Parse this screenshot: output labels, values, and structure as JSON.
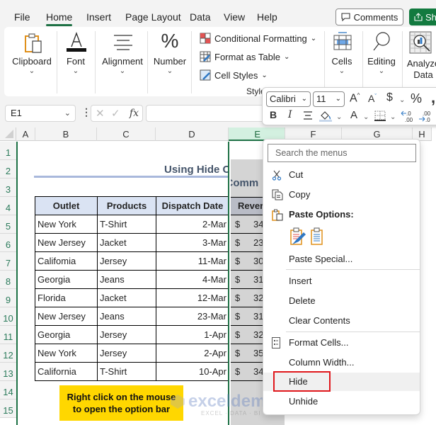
{
  "menubar": {
    "tabs": [
      "File",
      "Home",
      "Insert",
      "Page Layout",
      "Data",
      "View",
      "Help"
    ],
    "active_tab": "Home",
    "comments_label": "Comments",
    "share_label": "Sh"
  },
  "ribbon": {
    "groups": {
      "clipboard": "Clipboard",
      "font": "Font",
      "alignment": "Alignment",
      "number": "Number",
      "cells": "Cells",
      "editing": "Editing",
      "analyze_line1": "Analyze",
      "analyze_line2": "Data"
    },
    "styles": {
      "conditional_formatting": "Conditional Formatting",
      "format_as_table": "Format as Table",
      "cell_styles": "Cell Styles",
      "group_label": "Style"
    },
    "chevron": "⌄"
  },
  "formula_bar": {
    "name_box": "E1",
    "formula": "",
    "fx_label": "fx"
  },
  "mini_toolbar": {
    "font_name": "Calibri",
    "font_size": "11",
    "bold": "B",
    "italic": "I",
    "percent": "%",
    "currency": "$",
    "comma": ","
  },
  "grid": {
    "columns": [
      "A",
      "B",
      "C",
      "D",
      "E",
      "F",
      "G",
      "H"
    ],
    "selected_column": "E",
    "rows": [
      "1",
      "2",
      "3",
      "4",
      "5",
      "6",
      "7",
      "8",
      "9",
      "10",
      "11",
      "12",
      "13",
      "14",
      "15"
    ],
    "title": "Using Hide Comm",
    "table": {
      "headers": [
        "Outlet",
        "Products",
        "Dispatch Date",
        "Rever"
      ],
      "rows": [
        {
          "outlet": "New York",
          "product": "T-Shirt",
          "date": "2-Mar",
          "currency": "$",
          "revenue": "34"
        },
        {
          "outlet": "New Jersey",
          "product": "Jacket",
          "date": "3-Mar",
          "currency": "$",
          "revenue": "23"
        },
        {
          "outlet": "Califomia",
          "product": "Jersey",
          "date": "11-Mar",
          "currency": "$",
          "revenue": "30"
        },
        {
          "outlet": "Georgia",
          "product": "Jeans",
          "date": "4-Mar",
          "currency": "$",
          "revenue": "31"
        },
        {
          "outlet": "Florida",
          "product": "Jacket",
          "date": "12-Mar",
          "currency": "$",
          "revenue": "32"
        },
        {
          "outlet": "New Jersey",
          "product": "Jeans",
          "date": "23-Mar",
          "currency": "$",
          "revenue": "31"
        },
        {
          "outlet": "Georgia",
          "product": "Jersey",
          "date": "1-Apr",
          "currency": "$",
          "revenue": "32"
        },
        {
          "outlet": "New York",
          "product": "Jersey",
          "date": "2-Apr",
          "currency": "$",
          "revenue": "35"
        },
        {
          "outlet": "California",
          "product": "T-Shirt",
          "date": "10-Apr",
          "currency": "$",
          "revenue": "34"
        }
      ]
    },
    "note_line1": "Right click on the mouse",
    "note_line2": "to open the option bar",
    "watermark": "exceldemy",
    "watermark_tag": "EXCEL · DATA · BI"
  },
  "context_menu": {
    "search_placeholder": "Search the menus",
    "items": {
      "cut": "Cut",
      "copy": "Copy",
      "paste_options": "Paste Options:",
      "paste_special": "Paste Special...",
      "insert": "Insert",
      "delete": "Delete",
      "clear_contents": "Clear Contents",
      "format_cells": "Format Cells...",
      "column_width": "Column Width...",
      "hide": "Hide",
      "unhide": "Unhide"
    },
    "highlighted_item": "Hide"
  },
  "colors": {
    "accent_green": "#1e7145",
    "share_green": "#127a3f",
    "header_fill": "#dae3f3",
    "note_yellow": "#ffd700",
    "highlight_red": "#e0181c",
    "title_color": "#44546a"
  }
}
